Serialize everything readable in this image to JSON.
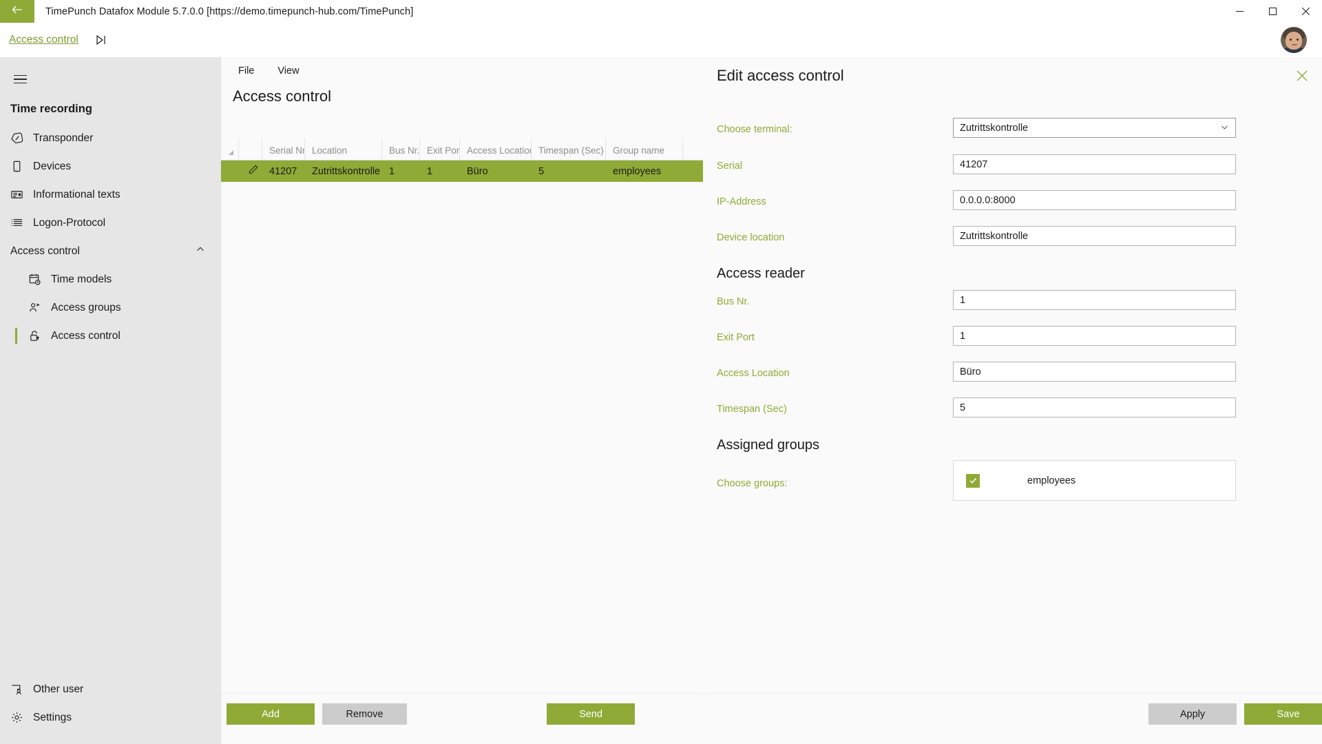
{
  "window": {
    "title": "TimePunch Datafox Module 5.7.0.0 [https://demo.timepunch-hub.com/TimePunch]",
    "back_icon": "arrow-left-icon",
    "minimize_label": "─",
    "maximize_label": "❐",
    "close_label": "✕",
    "accent_green": "#8faa36"
  },
  "breadcrumb": {
    "link": "Access control",
    "play_icon": "play-to-end-icon",
    "avatar_name": "user-avatar"
  },
  "sidebar": {
    "menu_icon": "hamburger-icon",
    "section_title": "Time recording",
    "items": [
      {
        "label": "Transponder",
        "icon": "transponder-tag-icon"
      },
      {
        "label": "Devices",
        "icon": "device-tablet-icon"
      },
      {
        "label": "Informational texts",
        "icon": "info-text-icon"
      },
      {
        "label": "Logon-Protocol",
        "icon": "list-icon"
      }
    ],
    "group": {
      "label": "Access control",
      "expanded": true,
      "chevron_icon": "chevron-up-icon",
      "children": [
        {
          "label": "Time models",
          "icon": "calendar-clock-icon",
          "selected": false
        },
        {
          "label": "Access groups",
          "icon": "people-group-icon",
          "selected": false
        },
        {
          "label": "Access control",
          "icon": "lock-key-icon",
          "selected": true
        }
      ]
    },
    "bottom_items": [
      {
        "label": "Other user",
        "icon": "switch-user-icon"
      },
      {
        "label": "Settings",
        "icon": "gear-icon"
      }
    ]
  },
  "center": {
    "menus": [
      "File",
      "View"
    ],
    "title": "Access control",
    "table": {
      "columns": [
        "",
        "",
        "Serial Nr.",
        "Location",
        "Bus Nr.",
        "Exit Port",
        "Access Location",
        "Timespan (Sec)",
        "Group name"
      ],
      "rows": [
        {
          "edit_icon": "pencil-icon",
          "serial": "41207",
          "location": "Zutrittskontrolle",
          "bus_nr": "1",
          "exit_port": "1",
          "access_location": "Büro",
          "timespan": "5",
          "group_name": "employees",
          "selected": true
        }
      ]
    },
    "buttons": {
      "add": "Add",
      "remove": "Remove",
      "send": "Send"
    }
  },
  "edit_panel": {
    "title": "Edit access control",
    "close_icon": "close-icon",
    "fields": [
      {
        "label": "Choose terminal:",
        "value": "Zutrittskontrolle",
        "type": "select"
      },
      {
        "label": "Serial",
        "value": "41207",
        "type": "text"
      },
      {
        "label": "IP-Address",
        "value": "0.0.0.0:8000",
        "type": "text"
      },
      {
        "label": "Device location",
        "value": "Zutrittskontrolle",
        "type": "text"
      }
    ],
    "access_reader": {
      "heading": "Access reader",
      "fields": [
        {
          "label": "Bus Nr.",
          "value": "1",
          "type": "text"
        },
        {
          "label": "Exit Port",
          "value": "1",
          "type": "text"
        },
        {
          "label": "Access Location",
          "value": "Büro",
          "type": "text"
        },
        {
          "label": "Timespan (Sec)",
          "value": "5",
          "type": "text"
        }
      ]
    },
    "assigned_groups": {
      "heading": "Assigned groups",
      "label": "Choose groups:",
      "groups": [
        {
          "name": "employees",
          "checked": true
        }
      ]
    },
    "buttons": {
      "apply": "Apply",
      "save": "Save"
    }
  }
}
